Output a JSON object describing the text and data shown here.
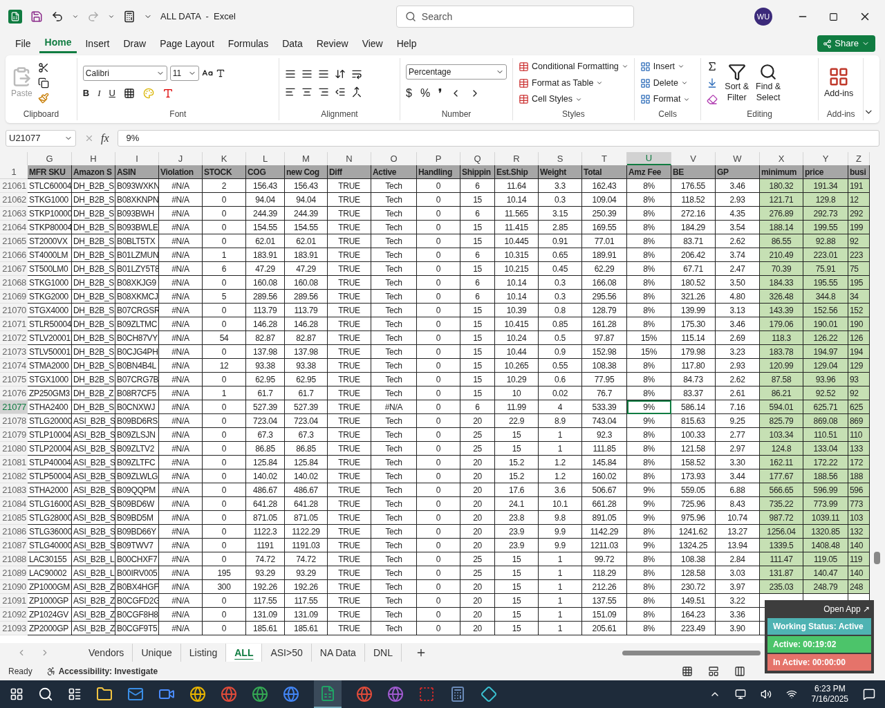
{
  "titlebar": {
    "title": "ALL DATA  -  Excel",
    "search": "Search",
    "avatar": "WU"
  },
  "menu": [
    {
      "label": "File",
      "selected": false
    },
    {
      "label": "Home",
      "selected": true
    },
    {
      "label": "Insert",
      "selected": false
    },
    {
      "label": "Draw",
      "selected": false
    },
    {
      "label": "Page Layout",
      "selected": false
    },
    {
      "label": "Formulas",
      "selected": false
    },
    {
      "label": "Data",
      "selected": false
    },
    {
      "label": "Review",
      "selected": false
    },
    {
      "label": "View",
      "selected": false
    },
    {
      "label": "Help",
      "selected": false
    }
  ],
  "share": "Share",
  "ribbon": {
    "clipboard": {
      "title": "Clipboard",
      "paste": "Paste"
    },
    "font": {
      "title": "Font",
      "family": "Calibri",
      "size": "11",
      "bold": "B",
      "italic": "I",
      "underline": "U"
    },
    "alignment": {
      "title": "Alignment"
    },
    "number": {
      "title": "Number",
      "format": "Percentage",
      "currency": "$",
      "percent": "%",
      "comma": "❜"
    },
    "styles": {
      "title": "Styles",
      "items": [
        "Conditional Formatting",
        "Format as Table",
        "Cell Styles"
      ]
    },
    "cells": {
      "title": "Cells",
      "items": [
        "Insert",
        "Delete",
        "Format"
      ]
    },
    "editing": {
      "title": "Editing",
      "sort": [
        "Sort &",
        "Filter"
      ],
      "find": [
        "Find &",
        "Select"
      ]
    },
    "addins": {
      "title": "Add-ins",
      "label": "Add-ins"
    }
  },
  "formula_bar": {
    "name_box": "U21077",
    "fx": "fx",
    "value": "9%"
  },
  "columns": [
    {
      "letter": "G",
      "header": "MFR SKU",
      "kind": "text",
      "selected": false
    },
    {
      "letter": "H",
      "header": "Amazon S",
      "kind": "text",
      "selected": false
    },
    {
      "letter": "I",
      "header": "ASIN",
      "kind": "text",
      "selected": false
    },
    {
      "letter": "J",
      "header": "Violation",
      "kind": "value",
      "selected": false
    },
    {
      "letter": "K",
      "header": "STOCK",
      "kind": "value",
      "selected": false
    },
    {
      "letter": "L",
      "header": "COG",
      "kind": "value",
      "selected": false
    },
    {
      "letter": "M",
      "header": "new Cog",
      "kind": "value",
      "selected": false
    },
    {
      "letter": "N",
      "header": "Diff",
      "kind": "value",
      "selected": false
    },
    {
      "letter": "O",
      "header": "Active",
      "kind": "value",
      "selected": false
    },
    {
      "letter": "P",
      "header": "Handling",
      "kind": "value",
      "selected": false
    },
    {
      "letter": "Q",
      "header": "Shippin",
      "kind": "value",
      "selected": false
    },
    {
      "letter": "R",
      "header": "Est.Ship",
      "kind": "value",
      "selected": false
    },
    {
      "letter": "S",
      "header": "Weight",
      "kind": "value",
      "selected": false
    },
    {
      "letter": "T",
      "header": "Total",
      "kind": "value",
      "selected": false
    },
    {
      "letter": "U",
      "header": "Amz Fee",
      "kind": "value",
      "selected": true
    },
    {
      "letter": "V",
      "header": "BE",
      "kind": "value",
      "selected": false
    },
    {
      "letter": "W",
      "header": "GP",
      "kind": "value",
      "selected": false
    },
    {
      "letter": "X",
      "header": "minimum",
      "kind": "highlight",
      "selected": false
    },
    {
      "letter": "Y",
      "header": "price",
      "kind": "highlight",
      "selected": false
    },
    {
      "letter": "Z",
      "header": "busi",
      "kind": "cut",
      "selected": false
    }
  ],
  "header_row": "1",
  "rows": [
    {
      "num": "21061",
      "selected": false,
      "cells": [
        "STLC60004",
        "DH_B2B_S",
        "B093WXKN",
        "#N/A",
        "2",
        "156.43",
        "156.43",
        "TRUE",
        "Tech",
        "0",
        "6",
        "11.64",
        "3.3",
        "162.43",
        "8%",
        "176.55",
        "3.46",
        "180.32",
        "191.34",
        "191"
      ]
    },
    {
      "num": "21062",
      "selected": false,
      "cells": [
        "STKG1000",
        "DH_B2B_S",
        "B08XKNPN",
        "#N/A",
        "0",
        "94.04",
        "94.04",
        "TRUE",
        "Tech",
        "0",
        "15",
        "10.14",
        "0.3",
        "109.04",
        "8%",
        "118.52",
        "2.93",
        "121.71",
        "129.8",
        "12"
      ]
    },
    {
      "num": "21063",
      "selected": false,
      "cells": [
        "STKP10000",
        "DH_B2B_S",
        "B093BWH",
        "#N/A",
        "0",
        "244.39",
        "244.39",
        "TRUE",
        "Tech",
        "0",
        "6",
        "11.565",
        "3.15",
        "250.39",
        "8%",
        "272.16",
        "4.35",
        "276.89",
        "292.73",
        "292"
      ]
    },
    {
      "num": "21064",
      "selected": false,
      "cells": [
        "STKP80004",
        "DH_B2B_S",
        "B093BWLE",
        "#N/A",
        "0",
        "154.55",
        "154.55",
        "TRUE",
        "Tech",
        "0",
        "15",
        "11.415",
        "2.85",
        "169.55",
        "8%",
        "184.29",
        "3.54",
        "188.14",
        "199.55",
        "199"
      ]
    },
    {
      "num": "21065",
      "selected": false,
      "cells": [
        "ST2000VX",
        "DH_B2B_S",
        "B0BLT5TX",
        "#N/A",
        "0",
        "62.01",
        "62.01",
        "TRUE",
        "Tech",
        "0",
        "15",
        "10.445",
        "0.91",
        "77.01",
        "8%",
        "83.71",
        "2.62",
        "86.55",
        "92.88",
        "92"
      ]
    },
    {
      "num": "21066",
      "selected": false,
      "cells": [
        "ST4000LM",
        "DH_B2B_S",
        "B01LZMUN",
        "#N/A",
        "1",
        "183.91",
        "183.91",
        "TRUE",
        "Tech",
        "0",
        "6",
        "10.315",
        "0.65",
        "189.91",
        "8%",
        "206.42",
        "3.74",
        "210.49",
        "223.01",
        "223"
      ]
    },
    {
      "num": "21067",
      "selected": false,
      "cells": [
        "ST500LM0",
        "DH_B2B_S",
        "B01LZY5T8",
        "#N/A",
        "6",
        "47.29",
        "47.29",
        "TRUE",
        "Tech",
        "0",
        "15",
        "10.215",
        "0.45",
        "62.29",
        "8%",
        "67.71",
        "2.47",
        "70.39",
        "75.91",
        "75"
      ]
    },
    {
      "num": "21068",
      "selected": false,
      "cells": [
        "STKG1000",
        "DH_B2B_S",
        "B08XKJG9",
        "#N/A",
        "0",
        "160.08",
        "160.08",
        "TRUE",
        "Tech",
        "0",
        "6",
        "10.14",
        "0.3",
        "166.08",
        "8%",
        "180.52",
        "3.50",
        "184.33",
        "195.55",
        "195"
      ]
    },
    {
      "num": "21069",
      "selected": false,
      "cells": [
        "STKG2000",
        "DH_B2B_S",
        "B08XKMCJ",
        "#N/A",
        "5",
        "289.56",
        "289.56",
        "TRUE",
        "Tech",
        "0",
        "6",
        "10.14",
        "0.3",
        "295.56",
        "8%",
        "321.26",
        "4.80",
        "326.48",
        "344.8",
        "34"
      ]
    },
    {
      "num": "21070",
      "selected": false,
      "cells": [
        "STGX4000",
        "DH_B2B_S",
        "B07CRGSR",
        "#N/A",
        "0",
        "113.79",
        "113.79",
        "TRUE",
        "Tech",
        "0",
        "15",
        "10.39",
        "0.8",
        "128.79",
        "8%",
        "139.99",
        "3.13",
        "143.39",
        "152.56",
        "152"
      ]
    },
    {
      "num": "21071",
      "selected": false,
      "cells": [
        "STLR50004",
        "DH_B2B_S",
        "B09ZLTMC",
        "#N/A",
        "0",
        "146.28",
        "146.28",
        "TRUE",
        "Tech",
        "0",
        "15",
        "10.415",
        "0.85",
        "161.28",
        "8%",
        "175.30",
        "3.46",
        "179.06",
        "190.01",
        "190"
      ]
    },
    {
      "num": "21072",
      "selected": false,
      "cells": [
        "STLV20001",
        "DH_B2B_S",
        "B0CH87VY",
        "#N/A",
        "54",
        "82.87",
        "82.87",
        "TRUE",
        "Tech",
        "0",
        "15",
        "10.24",
        "0.5",
        "97.87",
        "15%",
        "115.14",
        "2.69",
        "118.3",
        "126.22",
        "126"
      ]
    },
    {
      "num": "21073",
      "selected": false,
      "cells": [
        "STLV50001",
        "DH_B2B_S",
        "B0CJG4PH",
        "#N/A",
        "0",
        "137.98",
        "137.98",
        "TRUE",
        "Tech",
        "0",
        "15",
        "10.44",
        "0.9",
        "152.98",
        "15%",
        "179.98",
        "3.23",
        "183.78",
        "194.97",
        "194"
      ]
    },
    {
      "num": "21074",
      "selected": false,
      "cells": [
        "STMA2000",
        "DH_B2B_S",
        "B0BN4B4L",
        "#N/A",
        "12",
        "93.38",
        "93.38",
        "TRUE",
        "Tech",
        "0",
        "15",
        "10.265",
        "0.55",
        "108.38",
        "8%",
        "117.80",
        "2.93",
        "120.99",
        "129.04",
        "129"
      ]
    },
    {
      "num": "21075",
      "selected": false,
      "cells": [
        "STGX1000",
        "DH_B2B_S",
        "B07CRG7B",
        "#N/A",
        "0",
        "62.95",
        "62.95",
        "TRUE",
        "Tech",
        "0",
        "15",
        "10.29",
        "0.6",
        "77.95",
        "8%",
        "84.73",
        "2.62",
        "87.58",
        "93.96",
        "93"
      ]
    },
    {
      "num": "21076",
      "selected": false,
      "cells": [
        "ZP250GM3",
        "DH_B2B_Z",
        "B08R7CF5",
        "#N/A",
        "1",
        "61.7",
        "61.7",
        "TRUE",
        "Tech",
        "0",
        "15",
        "10",
        "0.02",
        "76.7",
        "8%",
        "83.37",
        "2.61",
        "86.21",
        "92.52",
        "92"
      ]
    },
    {
      "num": "21077",
      "selected": true,
      "cells": [
        "STHA2400",
        "DH_B2B_S",
        "B0CNXWJ",
        "#N/A",
        "0",
        "527.39",
        "527.39",
        "TRUE",
        "#N/A",
        "0",
        "6",
        "11.99",
        "4",
        "533.39",
        "9%",
        "586.14",
        "7.16",
        "594.01",
        "625.71",
        "625"
      ]
    },
    {
      "num": "21078",
      "selected": false,
      "cells": [
        "STLG20000",
        "ASI_B2B_S",
        "B09BD6RS",
        "#N/A",
        "0",
        "723.04",
        "723.04",
        "TRUE",
        "Tech",
        "0",
        "20",
        "22.9",
        "8.9",
        "743.04",
        "9%",
        "815.63",
        "9.25",
        "825.79",
        "869.08",
        "869"
      ]
    },
    {
      "num": "21079",
      "selected": false,
      "cells": [
        "STLP10004",
        "ASI_B2B_S",
        "B09ZLSJN",
        "#N/A",
        "0",
        "67.3",
        "67.3",
        "TRUE",
        "Tech",
        "0",
        "25",
        "15",
        "1",
        "92.3",
        "8%",
        "100.33",
        "2.77",
        "103.34",
        "110.51",
        "110"
      ]
    },
    {
      "num": "21080",
      "selected": false,
      "cells": [
        "STLP20004",
        "ASI_B2B_S",
        "B09ZLTV2",
        "#N/A",
        "0",
        "86.85",
        "86.85",
        "TRUE",
        "Tech",
        "0",
        "25",
        "15",
        "1",
        "111.85",
        "8%",
        "121.58",
        "2.97",
        "124.8",
        "133.04",
        "133"
      ]
    },
    {
      "num": "21081",
      "selected": false,
      "cells": [
        "STLP40004",
        "ASI_B2B_S",
        "B09ZLTFC",
        "#N/A",
        "0",
        "125.84",
        "125.84",
        "TRUE",
        "Tech",
        "0",
        "20",
        "15.2",
        "1.2",
        "145.84",
        "8%",
        "158.52",
        "3.30",
        "162.11",
        "172.22",
        "172"
      ]
    },
    {
      "num": "21082",
      "selected": false,
      "cells": [
        "STLP50004",
        "ASI_B2B_S",
        "B09ZLWLG",
        "#N/A",
        "0",
        "140.02",
        "140.02",
        "TRUE",
        "Tech",
        "0",
        "20",
        "15.2",
        "1.2",
        "160.02",
        "8%",
        "173.93",
        "3.44",
        "177.67",
        "188.56",
        "188"
      ]
    },
    {
      "num": "21083",
      "selected": false,
      "cells": [
        "STHA2000",
        "ASI_B2B_S",
        "B09QQPM",
        "#N/A",
        "0",
        "486.67",
        "486.67",
        "TRUE",
        "Tech",
        "0",
        "20",
        "17.6",
        "3.6",
        "506.67",
        "9%",
        "559.05",
        "6.88",
        "566.65",
        "596.99",
        "596"
      ]
    },
    {
      "num": "21084",
      "selected": false,
      "cells": [
        "STLG16000",
        "ASI_B2B_S",
        "B09BD6W",
        "#N/A",
        "0",
        "641.28",
        "641.28",
        "TRUE",
        "Tech",
        "0",
        "20",
        "24.1",
        "10.1",
        "661.28",
        "9%",
        "725.96",
        "8.43",
        "735.22",
        "773.99",
        "773"
      ]
    },
    {
      "num": "21085",
      "selected": false,
      "cells": [
        "STLG28000",
        "ASI_B2B_S",
        "B09BD5M",
        "#N/A",
        "0",
        "871.05",
        "871.05",
        "TRUE",
        "Tech",
        "0",
        "20",
        "23.8",
        "9.8",
        "891.05",
        "9%",
        "975.96",
        "10.74",
        "987.72",
        "1039.11",
        "103"
      ]
    },
    {
      "num": "21086",
      "selected": false,
      "cells": [
        "STLG36000",
        "ASI_B2B_S",
        "B09BD66Y",
        "#N/A",
        "0",
        "1122.3",
        "1122.29",
        "TRUE",
        "Tech",
        "0",
        "20",
        "23.9",
        "9.9",
        "1142.29",
        "8%",
        "1241.62",
        "13.27",
        "1256.04",
        "1320.85",
        "132"
      ]
    },
    {
      "num": "21087",
      "selected": false,
      "cells": [
        "STLG40000",
        "ASI_B2B_S",
        "B09TWV7",
        "#N/A",
        "0",
        "1191",
        "1191.03",
        "TRUE",
        "Tech",
        "0",
        "20",
        "23.9",
        "9.9",
        "1211.03",
        "9%",
        "1324.25",
        "13.94",
        "1339.5",
        "1408.48",
        "140"
      ]
    },
    {
      "num": "21088",
      "selected": false,
      "cells": [
        "LAC30155",
        "ASI_B2B_L",
        "B00CHXF7",
        "#N/A",
        "0",
        "74.72",
        "74.72",
        "TRUE",
        "Tech",
        "0",
        "25",
        "15",
        "1",
        "99.72",
        "8%",
        "108.38",
        "2.84",
        "111.47",
        "119.05",
        "119"
      ]
    },
    {
      "num": "21089",
      "selected": false,
      "cells": [
        "LAC90002",
        "ASI_B2B_L",
        "B00IRV005",
        "#N/A",
        "195",
        "93.29",
        "93.29",
        "TRUE",
        "Tech",
        "0",
        "25",
        "15",
        "1",
        "118.29",
        "8%",
        "128.58",
        "3.03",
        "131.87",
        "140.47",
        "140"
      ]
    },
    {
      "num": "21090",
      "selected": false,
      "cells": [
        "ZP1000GM",
        "ASI_B2B_Z",
        "B0BX4HGF",
        "#N/A",
        "300",
        "192.26",
        "192.26",
        "TRUE",
        "Tech",
        "0",
        "20",
        "15",
        "1",
        "212.26",
        "8%",
        "230.72",
        "3.97",
        "235.03",
        "248.79",
        "248"
      ]
    },
    {
      "num": "21091",
      "selected": false,
      "cells": [
        "ZP1000GP",
        "ASI_B2B_Z",
        "B0CGFD2G",
        "#N/A",
        "0",
        "117.55",
        "117.55",
        "TRUE",
        "Tech",
        "0",
        "20",
        "15",
        "1",
        "137.55",
        "8%",
        "149.51",
        "3.22"
      ]
    },
    {
      "num": "21092",
      "selected": false,
      "cells": [
        "ZP1024GV",
        "ASI_B2B_Z",
        "B0CGF8H8",
        "#N/A",
        "0",
        "131.09",
        "131.09",
        "TRUE",
        "Tech",
        "0",
        "20",
        "15",
        "1",
        "151.09",
        "8%",
        "164.23",
        "3.36"
      ]
    },
    {
      "num": "21093",
      "selected": false,
      "cells": [
        "ZP2000GP",
        "ASI_B2B_Z",
        "B0CGF9T5",
        "#N/A",
        "0",
        "185.61",
        "185.61",
        "TRUE",
        "Tech",
        "0",
        "20",
        "15",
        "1",
        "205.61",
        "8%",
        "223.49",
        "3.90"
      ]
    }
  ],
  "sheets": [
    {
      "label": "Vendors",
      "selected": false
    },
    {
      "label": "Unique",
      "selected": false
    },
    {
      "label": "Listing",
      "selected": false
    },
    {
      "label": "ALL",
      "selected": true
    },
    {
      "label": "ASI>50",
      "selected": false
    },
    {
      "label": "NA Data",
      "selected": false
    },
    {
      "label": "DNL",
      "selected": false
    }
  ],
  "status": {
    "ready": "Ready",
    "accessibility": "Accessibility: Investigate"
  },
  "tracker": {
    "open": "Open App ↗",
    "status": "Working Status: Active",
    "active": "Active: 00:19:02",
    "inactive": "In Active: 00:00:00"
  },
  "clock": {
    "time": "6:23 PM",
    "date": "7/16/2025"
  }
}
